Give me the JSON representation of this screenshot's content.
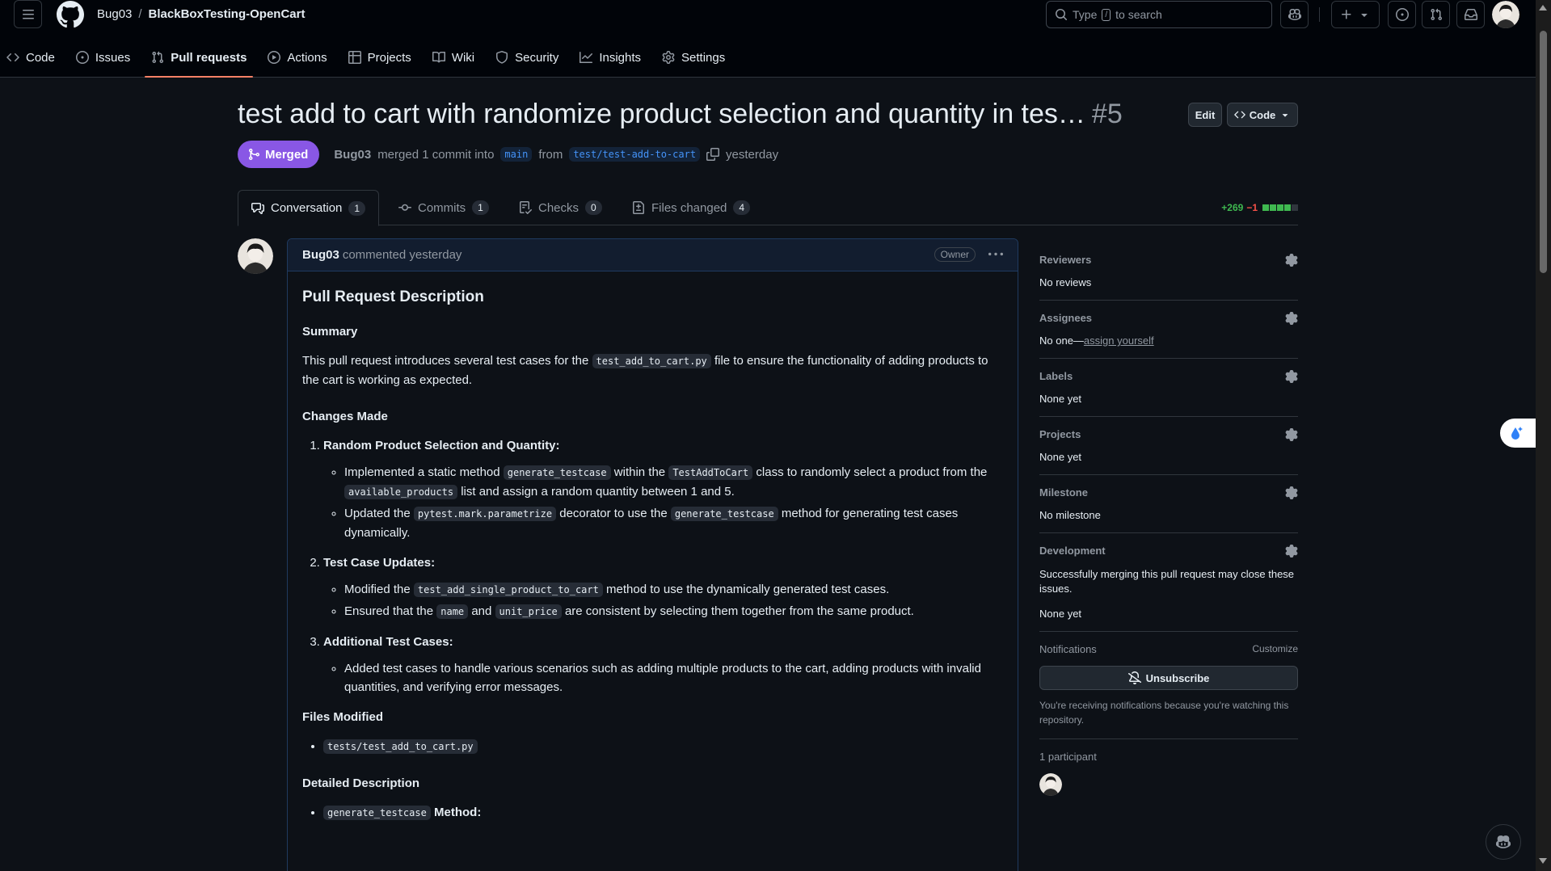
{
  "header": {
    "owner": "Bug03",
    "separator": "/",
    "repo": "BlackBoxTesting-OpenCart",
    "search_placeholder_pre": "Type",
    "search_key": "/",
    "search_placeholder_post": "to search"
  },
  "repo_nav": [
    {
      "label": "Code",
      "icon": "code-icon"
    },
    {
      "label": "Issues",
      "icon": "issue-icon"
    },
    {
      "label": "Pull requests",
      "icon": "pull-request-icon",
      "active": true
    },
    {
      "label": "Actions",
      "icon": "play-icon"
    },
    {
      "label": "Projects",
      "icon": "table-icon"
    },
    {
      "label": "Wiki",
      "icon": "book-icon"
    },
    {
      "label": "Security",
      "icon": "shield-icon"
    },
    {
      "label": "Insights",
      "icon": "graph-icon"
    },
    {
      "label": "Settings",
      "icon": "gear-icon"
    }
  ],
  "pr": {
    "title": "test add to cart with randomize product selection and quantity in tes…",
    "number": "#5",
    "edit_label": "Edit",
    "code_label": "Code",
    "state": "Merged",
    "author": "Bug03",
    "merge_text": "merged 1 commit into",
    "base_branch": "main",
    "from_text": "from",
    "head_branch": "test/test-add-to-cart",
    "when": "yesterday"
  },
  "tabs": [
    {
      "label": "Conversation",
      "count": "1",
      "icon": "comment-discussion-icon"
    },
    {
      "label": "Commits",
      "count": "1",
      "icon": "commit-icon"
    },
    {
      "label": "Checks",
      "count": "0",
      "icon": "checklist-icon"
    },
    {
      "label": "Files changed",
      "count": "4",
      "icon": "file-diff-icon"
    }
  ],
  "diffstat": {
    "additions": "+269",
    "deletions": "−1"
  },
  "comment": {
    "author": "Bug03",
    "action": "commented yesterday",
    "badge": "Owner",
    "h_description": "Pull Request Description",
    "h_summary": "Summary",
    "summary_pre": "This pull request introduces several test cases for the",
    "summary_code": "test_add_to_cart.py",
    "summary_post": "file to ensure the functionality of adding products to the cart is working as expected.",
    "h_changes": "Changes Made",
    "item1_title": "Random Product Selection and Quantity:",
    "item1_b1_a": "Implemented a static method",
    "item1_b1_code1": "generate_testcase",
    "item1_b1_b": "within the",
    "item1_b1_code2": "TestAddToCart",
    "item1_b1_c": "class to randomly select a product from the",
    "item1_b1_code3": "available_products",
    "item1_b1_d": "list and assign a random quantity between 1 and 5.",
    "item1_b2_a": "Updated the",
    "item1_b2_code1": "pytest.mark.parametrize",
    "item1_b2_b": "decorator to use the",
    "item1_b2_code2": "generate_testcase",
    "item1_b2_c": "method for generating test cases dynamically.",
    "item2_title": "Test Case Updates:",
    "item2_b1_a": "Modified the",
    "item2_b1_code": "test_add_single_product_to_cart",
    "item2_b1_b": "method to use the dynamically generated test cases.",
    "item2_b2_a": "Ensured that the",
    "item2_b2_code1": "name",
    "item2_b2_b": "and",
    "item2_b2_code2": "unit_price",
    "item2_b2_c": "are consistent by selecting them together from the same product.",
    "item3_title": "Additional Test Cases:",
    "item3_b1": "Added test cases to handle various scenarios such as adding multiple products to the cart, adding products with invalid quantities, and verifying error messages.",
    "h_files": "Files Modified",
    "file1": "tests/test_add_to_cart.py",
    "h_detailed": "Detailed Description",
    "detail1_code": "generate_testcase",
    "detail1_post": "Method:"
  },
  "sidebar": {
    "reviewers_title": "Reviewers",
    "reviewers_value": "No reviews",
    "assignees_title": "Assignees",
    "assignees_value": "No one—",
    "assignees_link": "assign yourself",
    "labels_title": "Labels",
    "labels_value": "None yet",
    "projects_title": "Projects",
    "projects_value": "None yet",
    "milestone_title": "Milestone",
    "milestone_value": "No milestone",
    "development_title": "Development",
    "development_note": "Successfully merging this pull request may close these issues.",
    "development_value": "None yet",
    "notifications_title": "Notifications",
    "customize_label": "Customize",
    "unsubscribe_label": "Unsubscribe",
    "notifications_note": "You're receiving notifications because you're watching this repository.",
    "participants_title": "1 participant"
  },
  "colors": {
    "merged": "#8957e5",
    "tab_underline": "#f78166",
    "additions": "#3fb950",
    "deletions": "#f85149",
    "link": "#4493f8"
  }
}
